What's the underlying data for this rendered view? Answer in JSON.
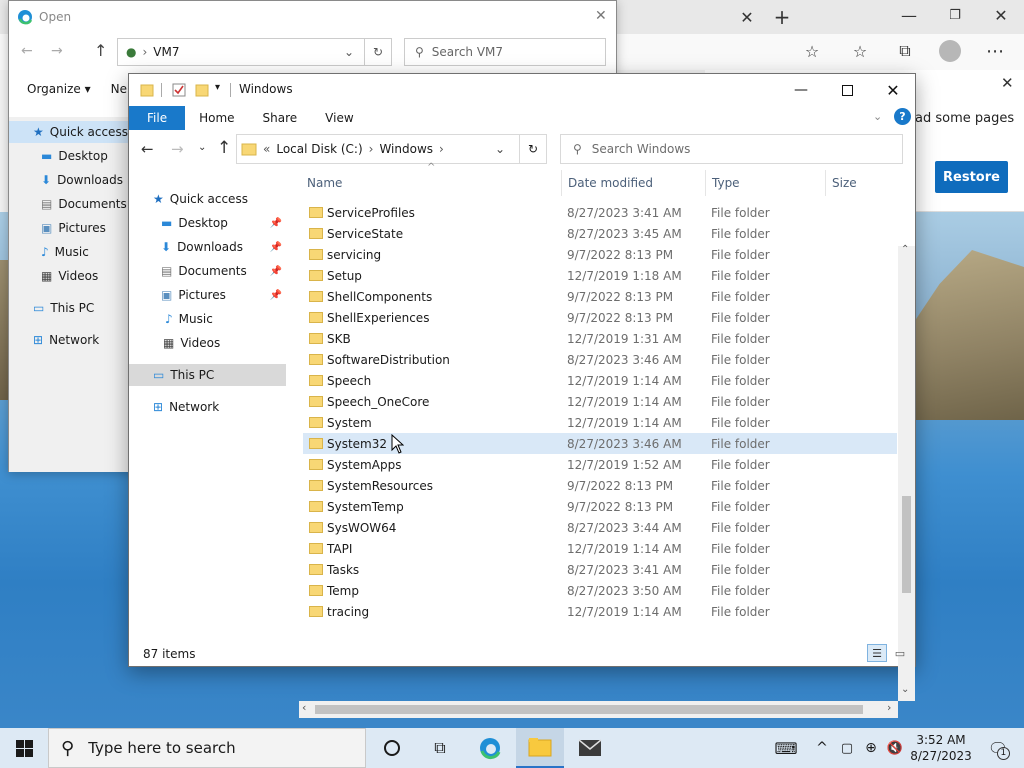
{
  "edge": {
    "panel_text": "ad some pages",
    "restore_label": "Restore"
  },
  "open_dialog": {
    "title": "Open",
    "address": "VM7",
    "search_placeholder": "Search VM7",
    "organize_label": "Organize",
    "new_label_partial": "Ne",
    "nav": [
      "Quick access",
      "Desktop",
      "Downloads",
      "Documents",
      "Pictures",
      "Music",
      "Videos",
      "This PC",
      "Network"
    ]
  },
  "explorer": {
    "title": "Windows",
    "ribbon_tabs": [
      "File",
      "Home",
      "Share",
      "View"
    ],
    "breadcrumb": {
      "overflow": "«",
      "drive": "Local Disk (C:)",
      "folder": "Windows"
    },
    "search_placeholder": "Search Windows",
    "nav": {
      "quick_access": "Quick access",
      "desktop": "Desktop",
      "downloads": "Downloads",
      "documents": "Documents",
      "pictures": "Pictures",
      "music": "Music",
      "videos": "Videos",
      "this_pc": "This PC",
      "network": "Network"
    },
    "columns": {
      "name": "Name",
      "date": "Date modified",
      "type": "Type",
      "size": "Size"
    },
    "rows": [
      {
        "name": "ServiceProfiles",
        "date": "8/27/2023 3:41 AM",
        "type": "File folder"
      },
      {
        "name": "ServiceState",
        "date": "8/27/2023 3:45 AM",
        "type": "File folder"
      },
      {
        "name": "servicing",
        "date": "9/7/2022 8:13 PM",
        "type": "File folder"
      },
      {
        "name": "Setup",
        "date": "12/7/2019 1:18 AM",
        "type": "File folder"
      },
      {
        "name": "ShellComponents",
        "date": "9/7/2022 8:13 PM",
        "type": "File folder"
      },
      {
        "name": "ShellExperiences",
        "date": "9/7/2022 8:13 PM",
        "type": "File folder"
      },
      {
        "name": "SKB",
        "date": "12/7/2019 1:31 AM",
        "type": "File folder"
      },
      {
        "name": "SoftwareDistribution",
        "date": "8/27/2023 3:46 AM",
        "type": "File folder"
      },
      {
        "name": "Speech",
        "date": "12/7/2019 1:14 AM",
        "type": "File folder"
      },
      {
        "name": "Speech_OneCore",
        "date": "12/7/2019 1:14 AM",
        "type": "File folder"
      },
      {
        "name": "System",
        "date": "12/7/2019 1:14 AM",
        "type": "File folder"
      },
      {
        "name": "System32",
        "date": "8/27/2023 3:46 AM",
        "type": "File folder"
      },
      {
        "name": "SystemApps",
        "date": "12/7/2019 1:52 AM",
        "type": "File folder"
      },
      {
        "name": "SystemResources",
        "date": "9/7/2022 8:13 PM",
        "type": "File folder"
      },
      {
        "name": "SystemTemp",
        "date": "9/7/2022 8:13 PM",
        "type": "File folder"
      },
      {
        "name": "SysWOW64",
        "date": "8/27/2023 3:44 AM",
        "type": "File folder"
      },
      {
        "name": "TAPI",
        "date": "12/7/2019 1:14 AM",
        "type": "File folder"
      },
      {
        "name": "Tasks",
        "date": "8/27/2023 3:41 AM",
        "type": "File folder"
      },
      {
        "name": "Temp",
        "date": "8/27/2023 3:50 AM",
        "type": "File folder"
      },
      {
        "name": "tracing",
        "date": "12/7/2019 1:14 AM",
        "type": "File folder"
      }
    ],
    "status_text": "87 items"
  },
  "taskbar": {
    "search_placeholder": "Type here to search",
    "time": "3:52 AM",
    "date": "8/27/2023",
    "notification_count": "1"
  },
  "colors": {
    "accent": "#1979ca",
    "selection": "#d9e8f7",
    "folder": "#f8d775"
  }
}
